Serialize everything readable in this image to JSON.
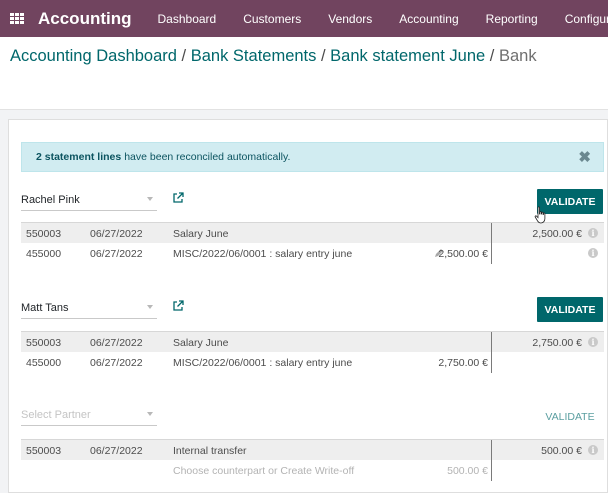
{
  "navbar": {
    "icon": "apps-grid-icon",
    "brand": "Accounting",
    "items": [
      "Dashboard",
      "Customers",
      "Vendors",
      "Accounting",
      "Reporting",
      "Configuration"
    ]
  },
  "breadcrumb": {
    "items": [
      "Accounting Dashboard",
      "Bank Statements",
      "Bank statement June"
    ],
    "separator": "/",
    "current": "Bank"
  },
  "alert": {
    "bold": "2 statement lines",
    "text": "have been reconciled automatically.",
    "close": "✖"
  },
  "blocks": [
    {
      "partner": "Rachel Pink",
      "validate_label": "VALIDATE",
      "lines": [
        {
          "account": "550003",
          "date": "06/27/2022",
          "label": "Salary June",
          "amount": "",
          "right_amount": "2,500.00 €",
          "info": true,
          "shaded": true
        },
        {
          "account": "455000",
          "date": "06/27/2022",
          "label": "MISC/2022/06/0001 : salary entry june",
          "amount": "2,500.00 €",
          "right_amount": "",
          "info": true,
          "pencil": true,
          "shaded": false
        }
      ]
    },
    {
      "partner": "Matt Tans",
      "validate_label": "VALIDATE",
      "lines": [
        {
          "account": "550003",
          "date": "06/27/2022",
          "label": "Salary June",
          "amount": "",
          "right_amount": "2,750.00 €",
          "info": true,
          "shaded": true
        },
        {
          "account": "455000",
          "date": "06/27/2022",
          "label": "MISC/2022/06/0001 : salary entry june",
          "amount": "2,750.00 €",
          "right_amount": "",
          "info": false,
          "shaded": false
        }
      ]
    },
    {
      "partner_placeholder": "Select Partner",
      "validate_label": "VALIDATE",
      "lines": [
        {
          "account": "550003",
          "date": "06/27/2022",
          "label": "Internal transfer",
          "amount": "",
          "right_amount": "500.00 €",
          "info": true,
          "shaded": true
        },
        {
          "account": "",
          "date": "",
          "label": "Choose counterpart or Create Write-off",
          "amount": "500.00 €",
          "right_amount": "",
          "info": false,
          "shaded": false,
          "muted": true
        }
      ]
    }
  ],
  "colors": {
    "navbar": "#71445f",
    "primary": "#00676b",
    "alert_bg": "#d1ecf1"
  }
}
